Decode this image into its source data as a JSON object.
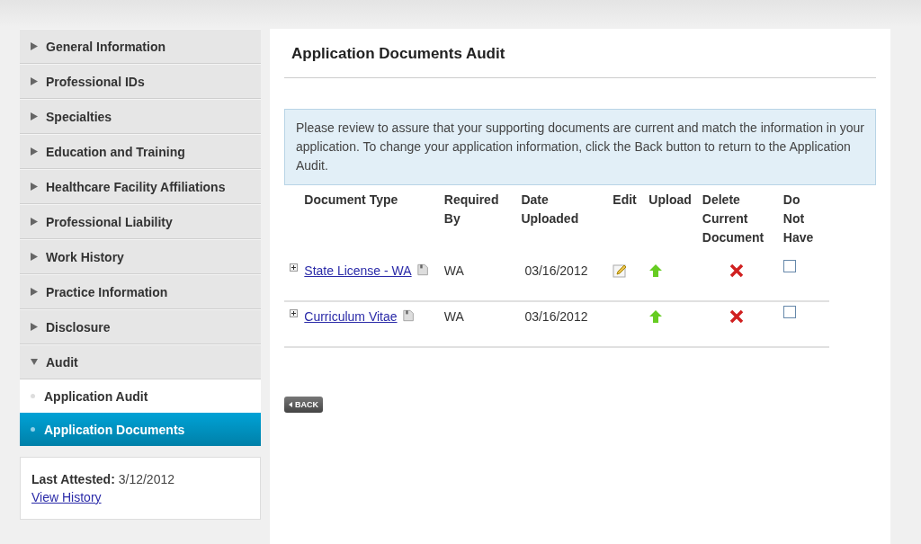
{
  "sidebar": {
    "items": [
      {
        "label": "General Information",
        "expanded": false
      },
      {
        "label": "Professional IDs",
        "expanded": false
      },
      {
        "label": "Specialties",
        "expanded": false
      },
      {
        "label": "Education and Training",
        "expanded": false
      },
      {
        "label": "Healthcare Facility Affiliations",
        "expanded": false
      },
      {
        "label": "Professional Liability",
        "expanded": false
      },
      {
        "label": "Work History",
        "expanded": false
      },
      {
        "label": "Practice Information",
        "expanded": false
      },
      {
        "label": "Disclosure",
        "expanded": false
      },
      {
        "label": "Audit",
        "expanded": true,
        "children": [
          {
            "label": "Application Audit",
            "selected": false
          },
          {
            "label": "Application Documents",
            "selected": true
          }
        ]
      }
    ]
  },
  "attestation": {
    "label": "Last Attested:",
    "date": "3/12/2012",
    "link": "View History"
  },
  "main": {
    "title": "Application Documents Audit",
    "notice": "Please review to assure that your supporting documents are current and match the information in your application. To change your application information, click the Back button to return to the Application Audit.",
    "table": {
      "columns": [
        "Document Type",
        "Required By",
        "Date Uploaded",
        "Edit",
        "Upload",
        "Delete Current Document",
        "Do Not Have"
      ],
      "rows": [
        {
          "document": "State License - WA",
          "required_by": "WA",
          "date": "03/16/2012",
          "editable": true,
          "do_not_have": false
        },
        {
          "document": "Curriculum Vitae",
          "required_by": "WA",
          "date": "03/16/2012",
          "editable": false,
          "do_not_have": false
        }
      ]
    },
    "back_button": "BACK"
  }
}
